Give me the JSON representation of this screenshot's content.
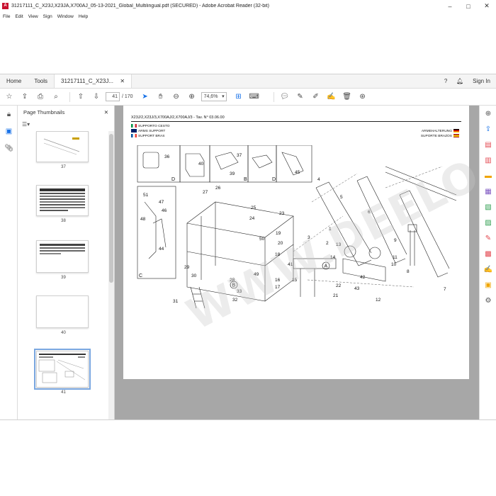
{
  "window": {
    "title": "31217111_C_X23J,X23JA,X700AJ_05-13-2021_Global_Multilingual.pdf (SECURED) - Adobe Acrobat Reader (32-bit)"
  },
  "menu": [
    "File",
    "Edit",
    "View",
    "Sign",
    "Window",
    "Help"
  ],
  "tabs": {
    "home": "Home",
    "tools": "Tools",
    "document": "31217111_C_X23J...",
    "sign_in": "Sign In"
  },
  "toolbar": {
    "current_page": "41",
    "page_count": "/ 170",
    "zoom": "74,6%"
  },
  "thumbnails_panel": {
    "title": "Page Thumbnails",
    "pages": [
      "37",
      "38",
      "39",
      "40",
      "41"
    ],
    "selected": "41"
  },
  "document": {
    "header": "X23J/2,X23J/3,X700AJ/2,X700AJ/3 - Tav. N° 03.06.00",
    "lang_it": "SUPPORTO CESTO",
    "lang_en": "ARMS SUPPORT",
    "lang_fr": "SUPPORT BRAS",
    "lang_de": "ARMEHALTERUNG",
    "lang_es": "SUPORTE BRAZOS",
    "watermark": "WWW.DEELO.COM",
    "callouts": [
      "36",
      "40",
      "37",
      "45",
      "51",
      "27",
      "26",
      "39",
      "39",
      "48",
      "47",
      "46",
      "44",
      "25",
      "24",
      "23",
      "50",
      "19",
      "20",
      "18",
      "41",
      "15",
      "16",
      "17",
      "14",
      "13",
      "12",
      "11",
      "10",
      "9",
      "8",
      "7",
      "6",
      "5",
      "4",
      "3",
      "2",
      "1",
      "28",
      "29",
      "30",
      "31",
      "32",
      "33",
      "43",
      "42",
      "22",
      "49",
      "21"
    ],
    "detail_labels": [
      "A",
      "B",
      "C",
      "D"
    ]
  },
  "colors": {
    "pdf_red": "#c8102e",
    "page_bg": "#a7a7a7",
    "accent_blue": "#1a73e8"
  },
  "icons": {
    "left_rail": [
      "lock-icon",
      "page-thumbnails-icon",
      "attachment-icon"
    ],
    "right_rail": [
      "zoom-in-icon",
      "export-pdf-icon",
      "create-pdf-icon",
      "edit-pdf-icon",
      "comment-icon",
      "combine-files-icon",
      "organize-pages-icon",
      "compress-pdf-icon",
      "redact-icon",
      "protect-icon",
      "fill-sign-icon",
      "send-icon",
      "more-tools-icon"
    ]
  }
}
